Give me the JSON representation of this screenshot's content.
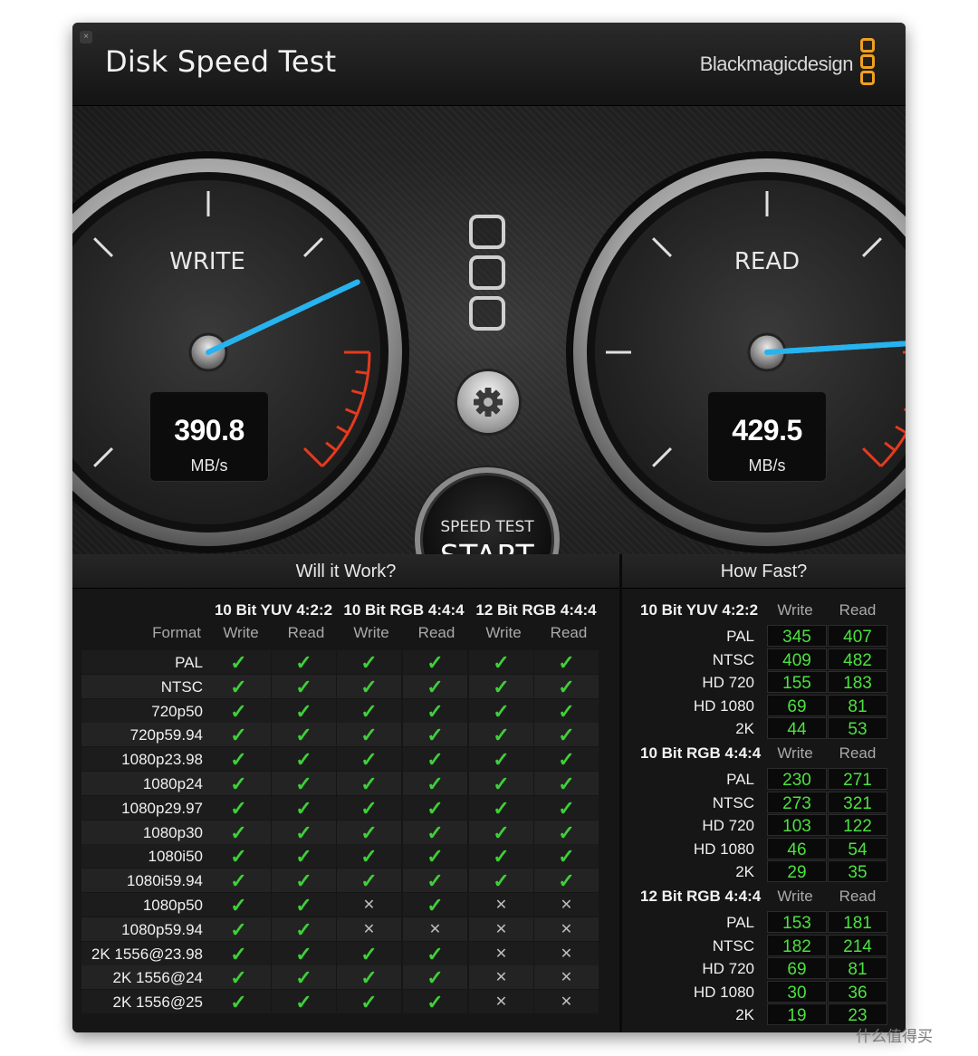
{
  "window": {
    "title": "Disk Speed Test",
    "brand": "Blackmagicdesign",
    "close_glyph": "×"
  },
  "gauges": {
    "write": {
      "label": "WRITE",
      "value": "390.8",
      "unit": "MB/s",
      "needle_fraction": 0.74
    },
    "read": {
      "label": "READ",
      "value": "429.5",
      "unit": "MB/s",
      "needle_fraction": 0.82
    }
  },
  "start_button": {
    "sub": "SPEED TEST",
    "main": "START"
  },
  "colors": {
    "needle": "#27b3ee",
    "check": "#3fcf3a",
    "number": "#4ce13f",
    "redline": "#e53a1e",
    "brand": "#f0a020"
  },
  "will_it_work": {
    "title": "Will it Work?",
    "format_header": "Format",
    "groups": [
      "10 Bit YUV 4:2:2",
      "10 Bit RGB 4:4:4",
      "12 Bit RGB 4:4:4"
    ],
    "col_write": "Write",
    "col_read": "Read",
    "rows": [
      {
        "format": "PAL",
        "marks": [
          "ok",
          "ok",
          "ok",
          "ok",
          "ok",
          "ok"
        ]
      },
      {
        "format": "NTSC",
        "marks": [
          "ok",
          "ok",
          "ok",
          "ok",
          "ok",
          "ok"
        ]
      },
      {
        "format": "720p50",
        "marks": [
          "ok",
          "ok",
          "ok",
          "ok",
          "ok",
          "ok"
        ]
      },
      {
        "format": "720p59.94",
        "marks": [
          "ok",
          "ok",
          "ok",
          "ok",
          "ok",
          "ok"
        ]
      },
      {
        "format": "1080p23.98",
        "marks": [
          "ok",
          "ok",
          "ok",
          "ok",
          "ok",
          "ok"
        ]
      },
      {
        "format": "1080p24",
        "marks": [
          "ok",
          "ok",
          "ok",
          "ok",
          "ok",
          "ok"
        ]
      },
      {
        "format": "1080p29.97",
        "marks": [
          "ok",
          "ok",
          "ok",
          "ok",
          "ok",
          "ok"
        ]
      },
      {
        "format": "1080p30",
        "marks": [
          "ok",
          "ok",
          "ok",
          "ok",
          "ok",
          "ok"
        ]
      },
      {
        "format": "1080i50",
        "marks": [
          "ok",
          "ok",
          "ok",
          "ok",
          "ok",
          "ok"
        ]
      },
      {
        "format": "1080i59.94",
        "marks": [
          "ok",
          "ok",
          "ok",
          "ok",
          "ok",
          "ok"
        ]
      },
      {
        "format": "1080p50",
        "marks": [
          "ok",
          "ok",
          "no",
          "ok",
          "no",
          "no"
        ]
      },
      {
        "format": "1080p59.94",
        "marks": [
          "ok",
          "ok",
          "no",
          "no",
          "no",
          "no"
        ]
      },
      {
        "format": "2K 1556@23.98",
        "marks": [
          "ok",
          "ok",
          "ok",
          "ok",
          "no",
          "no"
        ]
      },
      {
        "format": "2K 1556@24",
        "marks": [
          "ok",
          "ok",
          "ok",
          "ok",
          "no",
          "no"
        ]
      },
      {
        "format": "2K 1556@25",
        "marks": [
          "ok",
          "ok",
          "ok",
          "ok",
          "no",
          "no"
        ]
      }
    ]
  },
  "how_fast": {
    "title": "How Fast?",
    "col_write": "Write",
    "col_read": "Read",
    "groups": [
      {
        "name": "10 Bit YUV 4:2:2",
        "rows": [
          {
            "format": "PAL",
            "write": "345",
            "read": "407"
          },
          {
            "format": "NTSC",
            "write": "409",
            "read": "482"
          },
          {
            "format": "HD 720",
            "write": "155",
            "read": "183"
          },
          {
            "format": "HD 1080",
            "write": "69",
            "read": "81"
          },
          {
            "format": "2K",
            "write": "44",
            "read": "53"
          }
        ]
      },
      {
        "name": "10 Bit RGB 4:4:4",
        "rows": [
          {
            "format": "PAL",
            "write": "230",
            "read": "271"
          },
          {
            "format": "NTSC",
            "write": "273",
            "read": "321"
          },
          {
            "format": "HD 720",
            "write": "103",
            "read": "122"
          },
          {
            "format": "HD 1080",
            "write": "46",
            "read": "54"
          },
          {
            "format": "2K",
            "write": "29",
            "read": "35"
          }
        ]
      },
      {
        "name": "12 Bit RGB 4:4:4",
        "rows": [
          {
            "format": "PAL",
            "write": "153",
            "read": "181"
          },
          {
            "format": "NTSC",
            "write": "182",
            "read": "214"
          },
          {
            "format": "HD 720",
            "write": "69",
            "read": "81"
          },
          {
            "format": "HD 1080",
            "write": "30",
            "read": "36"
          },
          {
            "format": "2K",
            "write": "19",
            "read": "23"
          }
        ]
      }
    ]
  },
  "watermark": "什么值得买"
}
